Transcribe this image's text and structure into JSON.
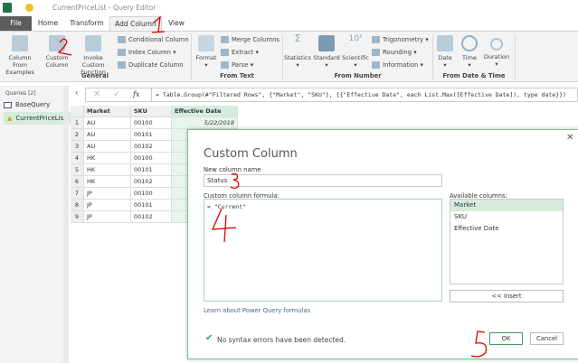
{
  "window": {
    "title": "CurrentPriceList - Query Editor"
  },
  "tabs": [
    "File",
    "Home",
    "Transform",
    "Add Column",
    "View"
  ],
  "ribbon": {
    "general": {
      "label": "General",
      "column_from_examples": "Column From\nExamples",
      "custom_column": "Custom\nColumn",
      "invoke_custom_function": "Invoke Custom\nFunction",
      "conditional_column": "Conditional Column",
      "index_column": "Index Column",
      "duplicate_column": "Duplicate Column"
    },
    "from_text": {
      "label": "From Text",
      "format": "Format",
      "merge_columns": "Merge Columns",
      "extract": "Extract",
      "parse": "Parse"
    },
    "from_number": {
      "label": "From Number",
      "statistics": "Statistics",
      "standard": "Standard",
      "scientific": "Scientific",
      "trigonometry": "Trigonometry",
      "rounding": "Rounding",
      "information": "Information"
    },
    "from_date_time": {
      "label": "From Date & Time",
      "date": "Date",
      "time": "Time",
      "duration": "Duration"
    }
  },
  "queries": {
    "header": "Queries [2]",
    "items": [
      "BaseQuery",
      "CurrentPriceList"
    ]
  },
  "formula_bar": {
    "formula": "= Table.Group(#\"Filtered Rows\", {\"Market\", \"SKU\"}, {{\"Effective Date\", each List.Max([Effective Date]), type date}})"
  },
  "table": {
    "columns": [
      "Market",
      "SKU",
      "Effective Date"
    ],
    "rows": [
      [
        "1",
        "AU",
        "00100",
        "5/22/2018"
      ],
      [
        "2",
        "AU",
        "00101",
        ""
      ],
      [
        "3",
        "AU",
        "00102",
        ""
      ],
      [
        "4",
        "HK",
        "00100",
        ""
      ],
      [
        "5",
        "HK",
        "00101",
        ""
      ],
      [
        "6",
        "HK",
        "00102",
        ""
      ],
      [
        "7",
        "JP",
        "00100",
        ""
      ],
      [
        "8",
        "JP",
        "00101",
        ""
      ],
      [
        "9",
        "JP",
        "00102",
        ""
      ]
    ]
  },
  "dialog": {
    "title": "Custom Column",
    "name_label": "New column name",
    "name_value": "Status",
    "formula_label": "Custom column formula:",
    "formula_value": "= \"Current\"",
    "available_label": "Available columns:",
    "available": [
      "Market",
      "SKU",
      "Effective Date"
    ],
    "insert": "<< Insert",
    "learn_link": "Learn about Power Query formulas",
    "status": "No syntax errors have been detected.",
    "ok": "OK",
    "cancel": "Cancel"
  },
  "annotations": [
    "1",
    "2",
    "3",
    "4",
    "5"
  ],
  "colors": {
    "accent": "#217346",
    "selection": "#d5ecdc",
    "annotation": "#e00000"
  }
}
